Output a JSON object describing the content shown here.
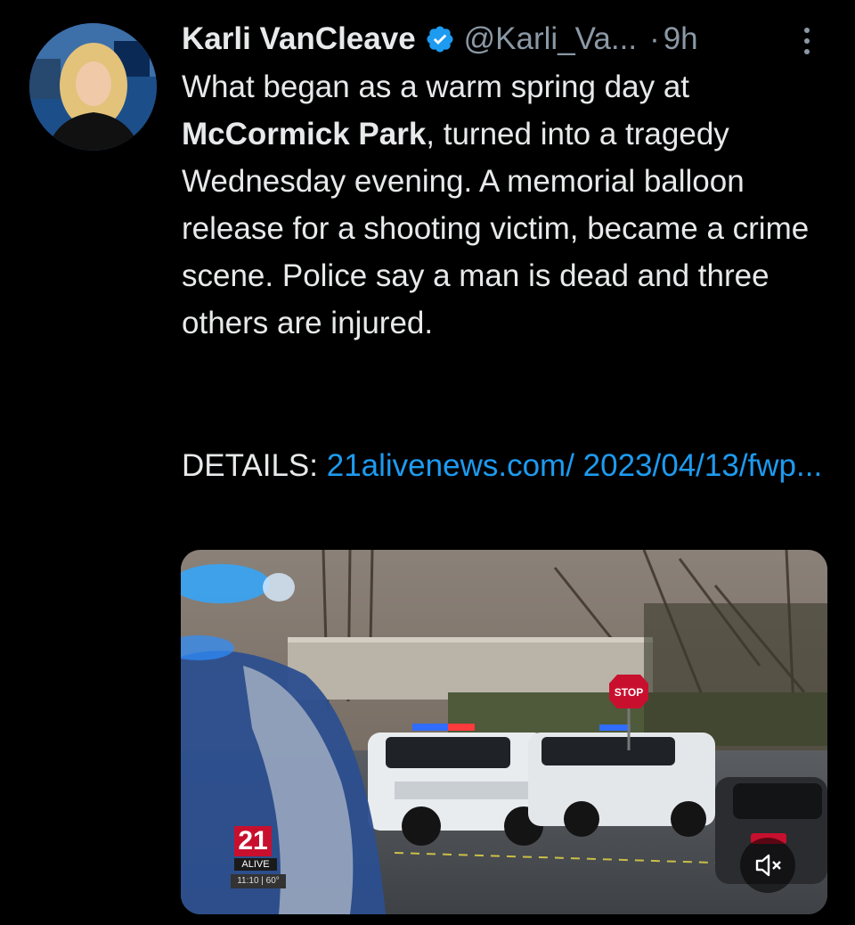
{
  "tweet": {
    "author_name": "Karli VanCleave",
    "handle": "@Karli_Va...",
    "separator": "·",
    "time": "9h",
    "body_line1": "What began as a warm spring day at ",
    "body_bold": "McCormick Park",
    "body_rest": ", turned into a tragedy Wednesday evening. A memorial balloon release for a shooting victim, became a crime scene. Police say a man is dead and three others are injured.",
    "details_label": "DETAILS: ",
    "details_link": "21alivenews.com/ 2023/04/13/fwp..."
  },
  "media": {
    "station_number": "21",
    "station_name": "ALIVE",
    "station_info": "11:10 | 60°",
    "stop_sign": "STOP"
  },
  "icons": {
    "verified": "verified-badge-icon",
    "more": "more-options-icon",
    "mute": "volume-mute-icon"
  },
  "colors": {
    "background": "#000000",
    "text": "#e7e9ea",
    "secondary": "#8b98a5",
    "link": "#1d9bf0",
    "verified": "#1d9bf0"
  }
}
